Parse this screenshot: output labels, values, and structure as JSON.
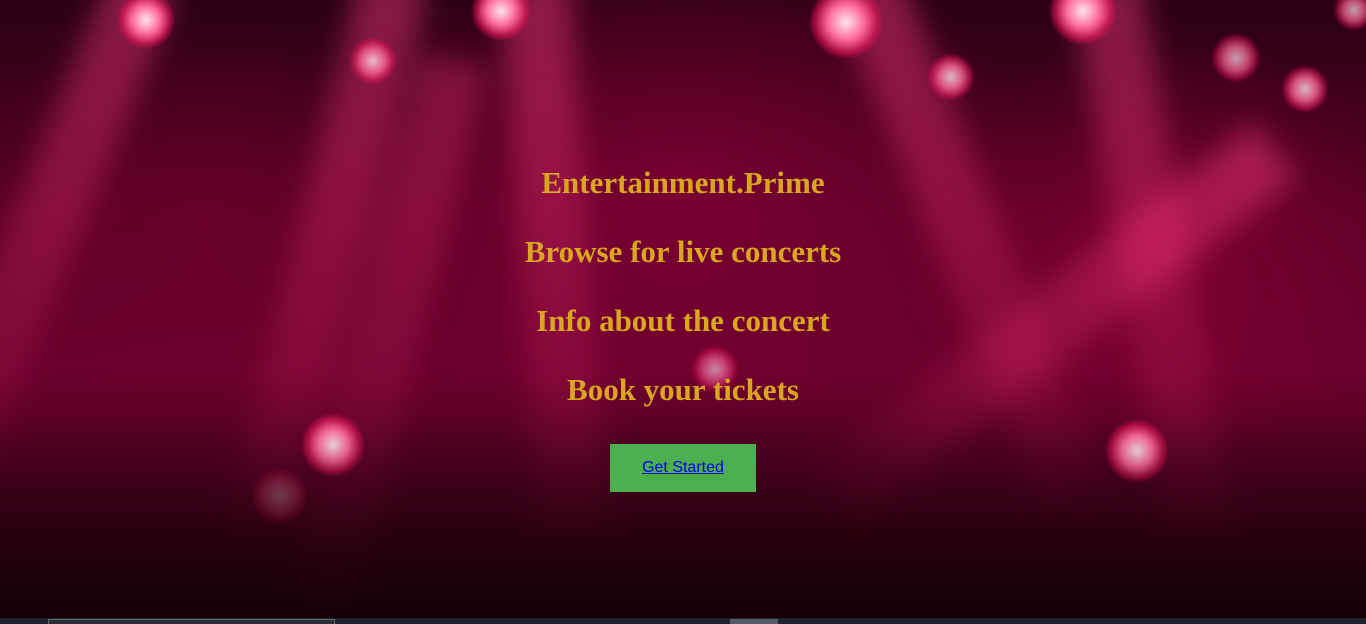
{
  "site": {
    "brand": "Entertainment.Prime"
  },
  "hero": {
    "lines": [
      "Browse for live concerts",
      "Info about the concert",
      "Book your tickets"
    ],
    "cta_label": "Get Started"
  },
  "colors": {
    "heading": "#daa520",
    "button_bg": "#4caf50",
    "link": "#0000ee",
    "background_accent": "#c8004a"
  }
}
